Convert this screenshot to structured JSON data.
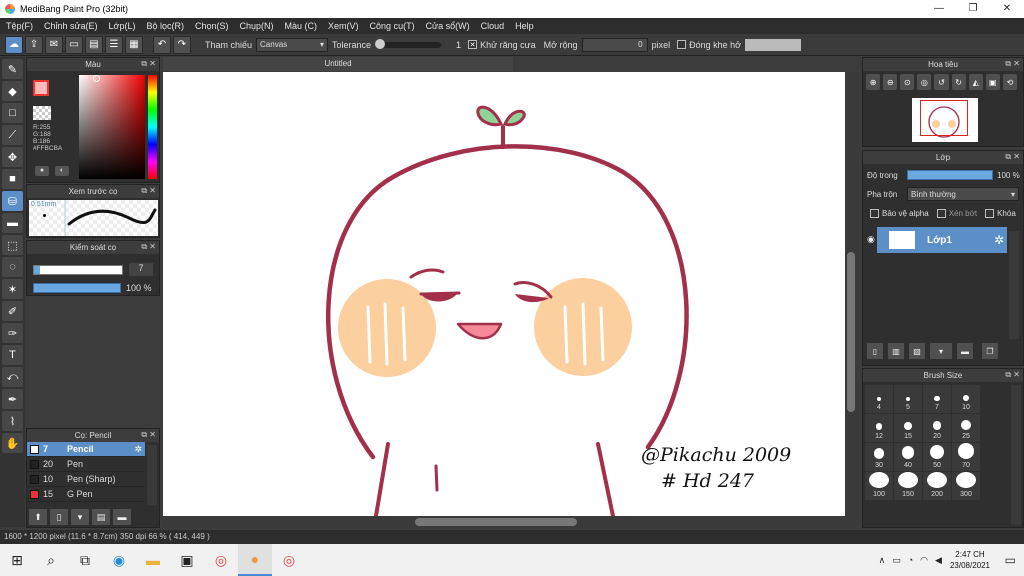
{
  "window": {
    "title": "MediBang Paint Pro (32bit)",
    "min": "—",
    "max": "❐",
    "close": "✕"
  },
  "menu": [
    "Tệp(F)",
    "Chỉnh sửa(E)",
    "Lớp(L)",
    "Bộ lọc(R)",
    "Chọn(S)",
    "Chụp(N)",
    "Màu (C)",
    "Xem(V)",
    "Công cụ(T)",
    "Cửa sổ(W)",
    "Cloud",
    "Help"
  ],
  "toolbar": {
    "tham_chieu_label": "Tham chiếu",
    "tham_chieu_value": "Canvas",
    "tolerance_label": "Tolerance",
    "tolerance_value": "1",
    "khu_rang_cua_label": "Khử răng cưa",
    "khu_rang_cua_checked": "✕",
    "mo_rong_label": "Mở rộng",
    "mo_rong_value": "0",
    "pixel_label": "pixel",
    "dong_khe_ho_label": "Đóng khe hở"
  },
  "color_panel": {
    "title": "Màu",
    "rgb": "R:255\nG:188\nB:186",
    "hex": "#FFBCBA",
    "fg_color": "#FFBCBA"
  },
  "preview_panel": {
    "title": "Xem trước cọ",
    "size": "0.51mm"
  },
  "control_panel": {
    "title": "Kiểm soát cọ",
    "size_value": "7",
    "opacity_value": "100 %",
    "size_fraction": 0.07,
    "opacity_fraction": 1.0
  },
  "brush_panel": {
    "title": "Cọ: Pencil",
    "brushes": [
      {
        "size": "7",
        "name": "Pencil",
        "color": "#ffffff",
        "active": true
      },
      {
        "size": "20",
        "name": "Pen",
        "color": "#222222"
      },
      {
        "size": "10",
        "name": "Pen (Sharp)",
        "color": "#222222"
      },
      {
        "size": "15",
        "name": "G Pen",
        "color": "#e33333"
      }
    ]
  },
  "canvas": {
    "tab": "Untitled",
    "signature": [
      "@Pikachu 2009",
      "# Hd 247"
    ]
  },
  "nav_panel": {
    "title": "Hoa tiêu"
  },
  "layer_panel": {
    "title": "Lớp",
    "opacity_label": "Độ trong",
    "opacity_value": "100 %",
    "blend_label": "Pha trộn",
    "blend_value": "Bình thường",
    "protect_alpha": "Bảo vệ alpha",
    "clip": "Xén bớt",
    "lock": "Khóa",
    "layer_name": "Lớp1"
  },
  "brush_size_panel": {
    "title": "Brush Size",
    "sizes": [
      "4",
      "5",
      "7",
      "10",
      "12",
      "15",
      "20",
      "25",
      "30",
      "40",
      "50",
      "70",
      "100",
      "150",
      "200",
      "300"
    ]
  },
  "status": "1600 * 1200 pixel   (11.6 * 8.7cm)   350 dpi   66 %   ( 414, 449 )",
  "taskbar": {
    "time": "2:47 CH",
    "date": "23/08/2021"
  }
}
